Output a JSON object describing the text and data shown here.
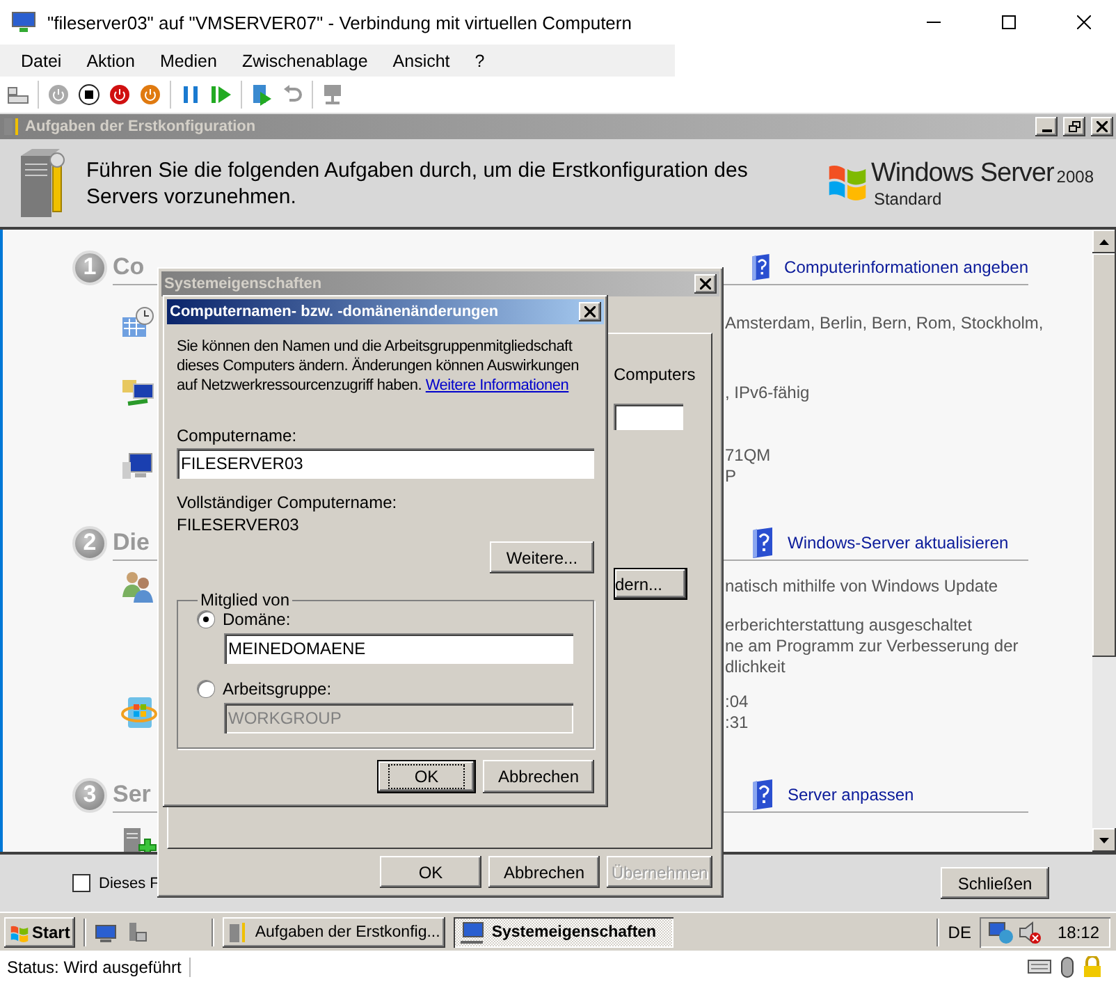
{
  "window": {
    "title": "\"fileserver03\" auf \"VMSERVER07\" - Verbindung mit virtuellen Computern"
  },
  "menu": [
    "Datei",
    "Aktion",
    "Medien",
    "Zwischenablage",
    "Ansicht",
    "?"
  ],
  "task_window": {
    "title": "Aufgaben der Erstkonfiguration",
    "active": false,
    "header_text": "Führen Sie die folgenden Aufgaben durch, um die Erstkonfiguration des Servers vorzunehmen.",
    "logo": {
      "name": "Windows Server",
      "version": "2008",
      "edition": "Standard"
    },
    "sections": [
      {
        "number": "1",
        "title": "Co",
        "link": "Computerinformationen angeben",
        "rows": [
          {
            "lines": [
              "Amsterdam, Berlin, Bern, Rom, Stockholm,"
            ]
          },
          {
            "lines": [
              ", IPv6-fähig"
            ]
          },
          {
            "lines": [
              "71QM",
              "P"
            ]
          }
        ]
      },
      {
        "number": "2",
        "title": "Die",
        "link": "Windows-Server aktualisieren",
        "rows": [
          {
            "lines": [
              "natisch mithilfe von Windows Update"
            ]
          },
          {
            "lines": [
              "erberichterstattung ausgeschaltet",
              "ne am Programm zur Verbesserung der",
              "dlichkeit"
            ]
          },
          {
            "lines": [
              ":04",
              ":31"
            ]
          }
        ]
      },
      {
        "number": "3",
        "title": "Ser",
        "link": "Server anpassen",
        "rows": [
          {
            "lines": []
          }
        ]
      }
    ],
    "footer": {
      "checkbox": {
        "label": "Dieses F",
        "checked": false
      },
      "close_button": "Schließen"
    }
  },
  "system_properties": {
    "title": "Systemeigenschaften",
    "active": false,
    "label": "Computers",
    "change_button": "dern...",
    "buttons": [
      {
        "label": "OK",
        "disabled": false
      },
      {
        "label": "Abbrechen",
        "disabled": false
      },
      {
        "label": "Übernehmen",
        "disabled": true
      }
    ]
  },
  "name_dialog": {
    "title": "Computernamen- bzw. -domänenänderungen",
    "active": true,
    "intro": "Sie können den Namen und die Arbeitsgruppenmitgliedschaft dieses Computers ändern. Änderungen können Auswirkungen auf Netzwerkressourcenzugriff haben.",
    "intro_link": "Weitere Informationen",
    "computer_name_label": "Computername:",
    "computer_name": "FILESERVER03",
    "full_name_label": "Vollständiger Computername:",
    "full_name": "FILESERVER03",
    "more_button": "Weitere...",
    "group_label": "Mitglied von",
    "options": [
      {
        "label": "Domäne:",
        "selected": true,
        "value": "MEINEDOMAENE"
      },
      {
        "label": "Arbeitsgruppe:",
        "selected": false,
        "value": "WORKGROUP"
      }
    ],
    "buttons": [
      {
        "label": "OK",
        "default": true
      },
      {
        "label": "Abbrechen",
        "default": false
      }
    ]
  },
  "taskbar": {
    "start": "Start",
    "tasks": [
      {
        "label": "Aufgaben der Erstkonfig...",
        "selected": false
      },
      {
        "label": "Systemeigenschaften",
        "selected": true
      }
    ],
    "language": "DE",
    "clock": "18:12"
  },
  "status_bar": {
    "text": "Status: Wird ausgeführt"
  }
}
